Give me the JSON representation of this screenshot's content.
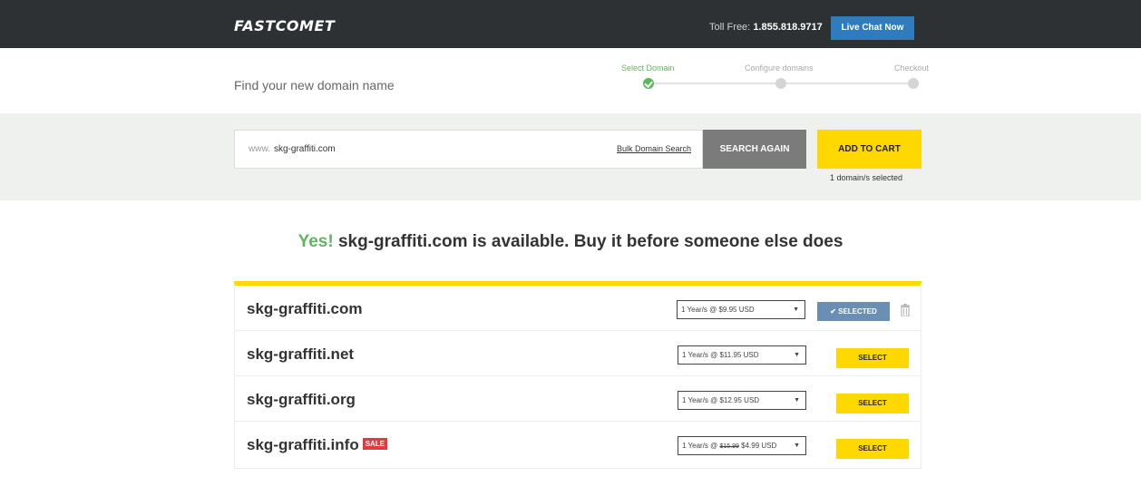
{
  "header": {
    "logo": "FASTCOMET",
    "toll_free_label": "Toll Free:",
    "toll_free_number": "1.855.818.9717",
    "live_chat": "Live Chat Now"
  },
  "steps": {
    "title": "Find your new domain name",
    "items": [
      {
        "label": "Select Domain",
        "state": "done"
      },
      {
        "label": "Configure domains",
        "state": "pending"
      },
      {
        "label": "Checkout",
        "state": "pending"
      }
    ]
  },
  "search": {
    "prefix": "www.",
    "value": "skg-graffiti.com",
    "bulk_link": "Bulk Domain Search",
    "search_again": "SEARCH AGAIN",
    "add_to_cart": "ADD TO CART",
    "selected_count": "1 domain/s selected"
  },
  "headline": {
    "yes": "Yes!",
    "text": " skg-graffiti.com is available. Buy it before someone else does"
  },
  "results": [
    {
      "domain": "skg-graffiti.com",
      "price": "1 Year/s @ $9.95 USD",
      "button": "✔ SELECTED",
      "selected": true
    },
    {
      "domain": "skg-graffiti.net",
      "price": "1 Year/s @ $11.95 USD",
      "button": "SELECT",
      "selected": false
    },
    {
      "domain": "skg-graffiti.org",
      "price": "1 Year/s @ $12.95 USD",
      "button": "SELECT",
      "selected": false
    },
    {
      "domain": "skg-graffiti.info",
      "badge": "SALE",
      "price_prefix": "1 Year/s @ ",
      "price_old": "$15.99",
      "price_new": " $4.99 USD",
      "button": "SELECT",
      "selected": false
    }
  ],
  "colors": {
    "topbar": "#2d3134",
    "accent_yellow": "#ffd800",
    "success_green": "#5cb85c",
    "live_chat_blue": "#2e7bbf",
    "selected_blue": "#6a8fb3",
    "sale_red": "#e03c3c"
  },
  "icons": {
    "step_done": "check-circle-icon",
    "remove": "trash-icon",
    "dropdown": "caret-down-icon"
  }
}
